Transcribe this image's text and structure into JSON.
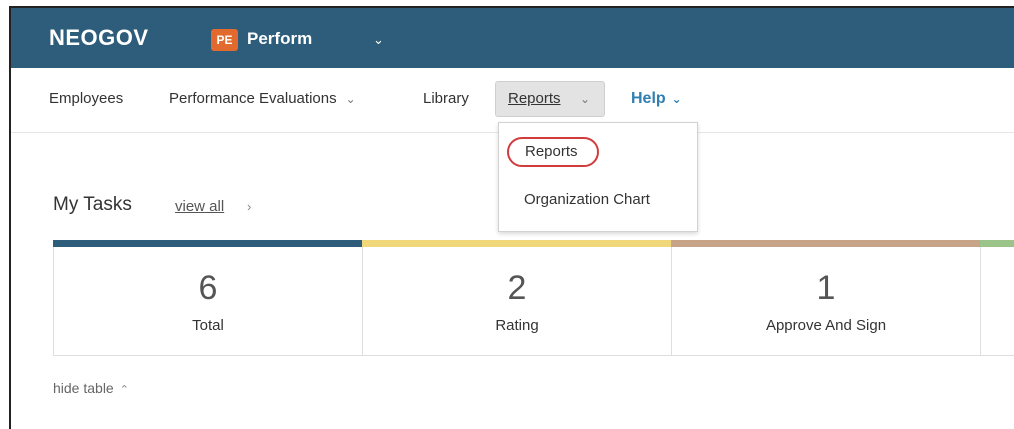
{
  "header": {
    "brand": "NEOGOV",
    "product_badge": "PE",
    "product_name": "Perform",
    "product_chevron": "⌄"
  },
  "nav": {
    "items": [
      {
        "label": "Employees"
      },
      {
        "label": "Performance Evaluations",
        "chevron": "⌄"
      },
      {
        "label": "Library"
      },
      {
        "label": "Reports",
        "chevron": "⌄"
      },
      {
        "label": "Help",
        "chevron": "⌄"
      }
    ]
  },
  "dropdown": {
    "items": [
      {
        "label": "Reports"
      },
      {
        "label": "Organization Chart"
      }
    ],
    "highlight_color": "#d23c3c"
  },
  "tasks": {
    "title": "My Tasks",
    "view_all": "view all",
    "view_all_chevron": "›",
    "cards": [
      {
        "count": "6",
        "label": "Total",
        "color": "#2d5d7b"
      },
      {
        "count": "2",
        "label": "Rating",
        "color": "#efd77a"
      },
      {
        "count": "1",
        "label": "Approve And Sign",
        "color": "#c7a488"
      },
      {
        "count": "",
        "label": "",
        "color": "#9bc48b"
      }
    ],
    "hide_table": "hide table",
    "hide_table_chevron": "⌃"
  }
}
